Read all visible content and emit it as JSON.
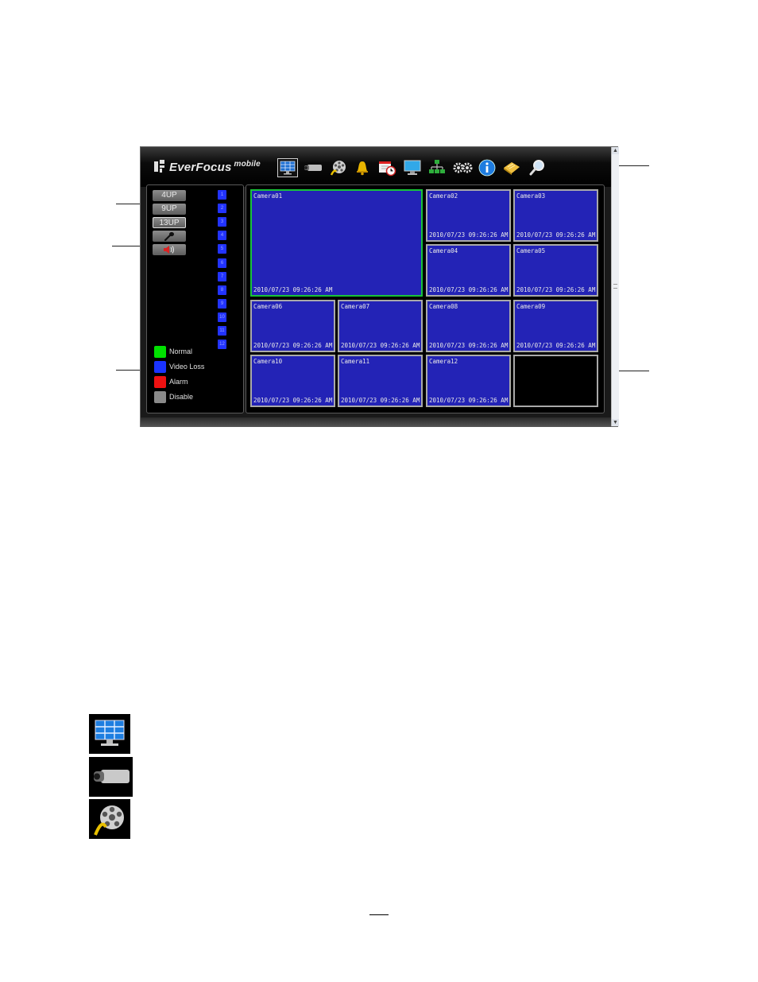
{
  "app": {
    "logo_text": "EverFocus",
    "logo_super": "mobile",
    "toolbar": [
      {
        "name": "live-view-icon",
        "active": true
      },
      {
        "name": "camera-icon",
        "active": false
      },
      {
        "name": "playback-reel-icon",
        "active": false
      },
      {
        "name": "alarm-bell-icon",
        "active": false
      },
      {
        "name": "schedule-icon",
        "active": false
      },
      {
        "name": "display-monitor-icon",
        "active": false
      },
      {
        "name": "network-icon",
        "active": false
      },
      {
        "name": "settings-gears-icon",
        "active": false
      },
      {
        "name": "info-icon",
        "active": false
      },
      {
        "name": "log-book-icon",
        "active": false
      },
      {
        "name": "search-icon",
        "active": false
      }
    ]
  },
  "left_panel": {
    "layout_buttons": [
      "4UP",
      "9UP",
      "13UP"
    ],
    "selected_layout": "13UP",
    "channels": [
      "1",
      "2",
      "3",
      "4",
      "5",
      "6",
      "7",
      "8",
      "9",
      "10",
      "11",
      "12"
    ],
    "legend": [
      {
        "label": "Normal",
        "color": "#00e000"
      },
      {
        "label": "Video Loss",
        "color": "#1a33ff"
      },
      {
        "label": "Alarm",
        "color": "#ee1111"
      },
      {
        "label": "Disable",
        "color": "#8a8a8a"
      }
    ]
  },
  "cameras": [
    {
      "name": "Camera01",
      "time": "2010/07/23  09:26:26 AM"
    },
    {
      "name": "Camera02",
      "time": "2010/07/23  09:26:26 AM"
    },
    {
      "name": "Camera03",
      "time": "2010/07/23  09:26:26 AM"
    },
    {
      "name": "Camera04",
      "time": "2010/07/23  09:26:26 AM"
    },
    {
      "name": "Camera05",
      "time": "2010/07/23  09:26:26 AM"
    },
    {
      "name": "Camera06",
      "time": "2010/07/23  09:26:26 AM"
    },
    {
      "name": "Camera07",
      "time": "2010/07/23  09:26:26 AM"
    },
    {
      "name": "Camera08",
      "time": "2010/07/23  09:26:26 AM"
    },
    {
      "name": "Camera09",
      "time": "2010/07/23  09:26:26 AM"
    },
    {
      "name": "Camera10",
      "time": "2010/07/23  09:26:26 AM"
    },
    {
      "name": "Camera11",
      "time": "2010/07/23  09:26:26 AM"
    },
    {
      "name": "Camera12",
      "time": "2010/07/23  09:26:26 AM"
    }
  ],
  "colors": {
    "video_tile": "#2323b6",
    "selected_border": "#18c23a",
    "tile_border": "#a9a9a9"
  }
}
